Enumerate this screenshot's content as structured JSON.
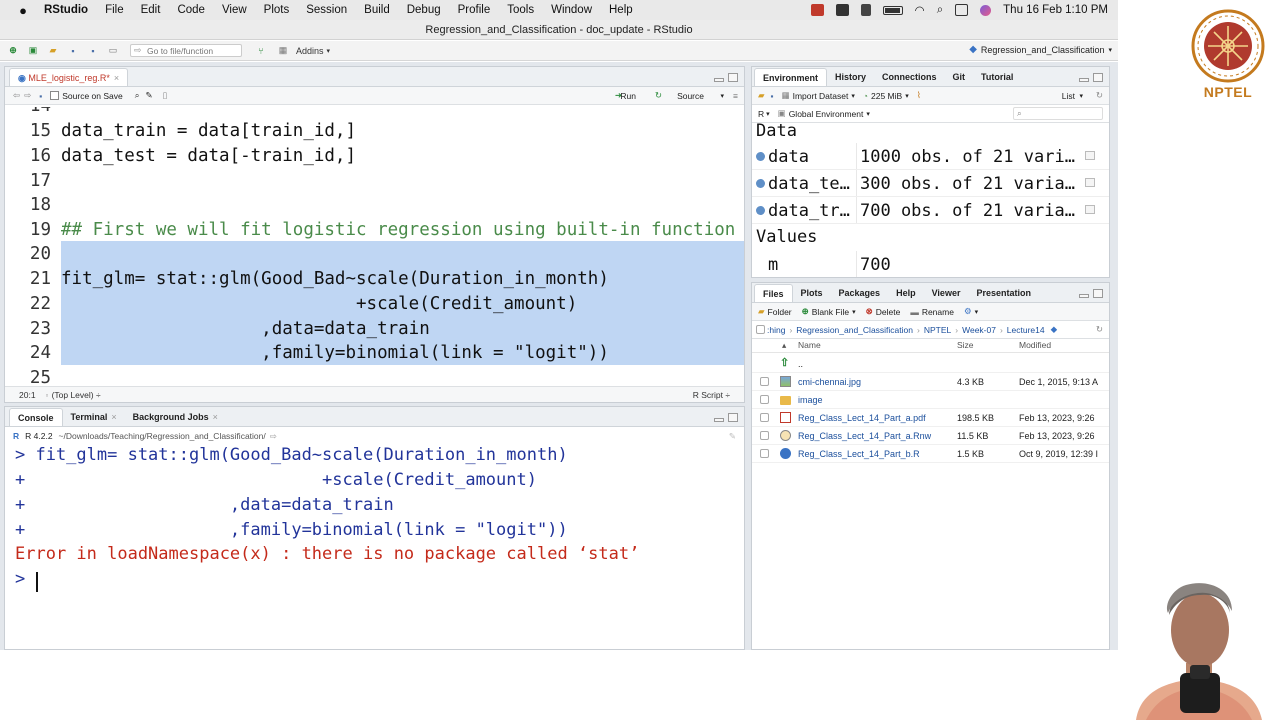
{
  "menubar": {
    "app": "RStudio",
    "items": [
      "File",
      "Edit",
      "Code",
      "View",
      "Plots",
      "Session",
      "Build",
      "Debug",
      "Profile",
      "Tools",
      "Window",
      "Help"
    ],
    "datetime": "Thu 16 Feb  1:10 PM"
  },
  "window": {
    "title": "Regression_and_Classification - doc_update - RStudio"
  },
  "toolbar": {
    "goto_placeholder": "Go to file/function",
    "addins": "Addins",
    "project": "Regression_and_Classification"
  },
  "source": {
    "tab_label": "MLE_logistic_reg.R*",
    "source_on_save": "Source on Save",
    "run_label": "Run",
    "source_label": "Source",
    "lines": [
      {
        "n": "14",
        "text": ""
      },
      {
        "n": "15",
        "text": "data_train = data[train_id,]"
      },
      {
        "n": "16",
        "text": "data_test = data[-train_id,]"
      },
      {
        "n": "17",
        "text": ""
      },
      {
        "n": "18",
        "text": ""
      },
      {
        "n": "19",
        "text": "## First we will fit logistic regression using built-in function"
      },
      {
        "n": "20",
        "text": ""
      },
      {
        "n": "21",
        "text": "fit_glm= stat::glm(Good_Bad~scale(Duration_in_month)"
      },
      {
        "n": "22",
        "text": "                            +scale(Credit_amount)"
      },
      {
        "n": "23",
        "text": "                   ,data=data_train"
      },
      {
        "n": "24",
        "text": "                   ,family=binomial(link = \"logit\"))"
      },
      {
        "n": "25",
        "text": ""
      }
    ],
    "cursor_pos": "20:1",
    "scope": "(Top Level) ÷",
    "filetype": "R Script ÷"
  },
  "console": {
    "tabs": [
      "Console",
      "Terminal",
      "Background Jobs"
    ],
    "version": "R 4.2.2",
    "path": "~/Downloads/Teaching/Regression_and_Classification/",
    "lines": [
      {
        "type": "cmd",
        "text": "> fit_glm= stat::glm(Good_Bad~scale(Duration_in_month)"
      },
      {
        "type": "cmd",
        "text": "+                             +scale(Credit_amount)"
      },
      {
        "type": "cmd",
        "text": "+                    ,data=data_train"
      },
      {
        "type": "cmd",
        "text": "+                    ,family=binomial(link = \"logit\"))"
      },
      {
        "type": "err",
        "text": "Error in loadNamespace(x) : there is no package called ‘stat’"
      },
      {
        "type": "cmd",
        "text": "> "
      }
    ]
  },
  "environment": {
    "tabs": [
      "Environment",
      "History",
      "Connections",
      "Git",
      "Tutorial"
    ],
    "import_label": "Import Dataset",
    "memory": "225 MiB",
    "list_label": "List",
    "lang": "R",
    "scope": "Global Environment",
    "data_header": "Data",
    "values_header": "Values",
    "data_rows": [
      {
        "name": "data",
        "value": "1000 obs. of 21 vari…"
      },
      {
        "name": "data_te…",
        "value": "300 obs. of 21 varia…"
      },
      {
        "name": "data_tr…",
        "value": "700 obs. of 21 varia…"
      }
    ],
    "value_rows": [
      {
        "name": "m",
        "value": "700"
      }
    ]
  },
  "files": {
    "tabs": [
      "Files",
      "Plots",
      "Packages",
      "Help",
      "Viewer",
      "Presentation"
    ],
    "folder_btn": "Folder",
    "blank_file_btn": "Blank File",
    "delete_btn": "Delete",
    "rename_btn": "Rename",
    "breadcrumb": [
      ":hing",
      "Regression_and_Classification",
      "NPTEL",
      "Week-07",
      "Lecture14"
    ],
    "col_name": "Name",
    "col_size": "Size",
    "col_modified": "Modified",
    "up_label": "..",
    "rows": [
      {
        "name": "cmi-chennai.jpg",
        "size": "4.3 KB",
        "modified": "Dec 1, 2015, 9:13 A",
        "kind": "img"
      },
      {
        "name": "image",
        "size": "",
        "modified": "",
        "kind": "folder"
      },
      {
        "name": "Reg_Class_Lect_14_Part_a.pdf",
        "size": "198.5 KB",
        "modified": "Feb 13, 2023, 9:26 ",
        "kind": "pdf"
      },
      {
        "name": "Reg_Class_Lect_14_Part_a.Rnw",
        "size": "11.5 KB",
        "modified": "Feb 13, 2023, 9:26 ",
        "kind": "rnw"
      },
      {
        "name": "Reg_Class_Lect_14_Part_b.R",
        "size": "1.5 KB",
        "modified": "Oct 9, 2019, 12:39 I",
        "kind": "r"
      }
    ]
  },
  "overlay": {
    "logo_text": "NPTEL"
  }
}
